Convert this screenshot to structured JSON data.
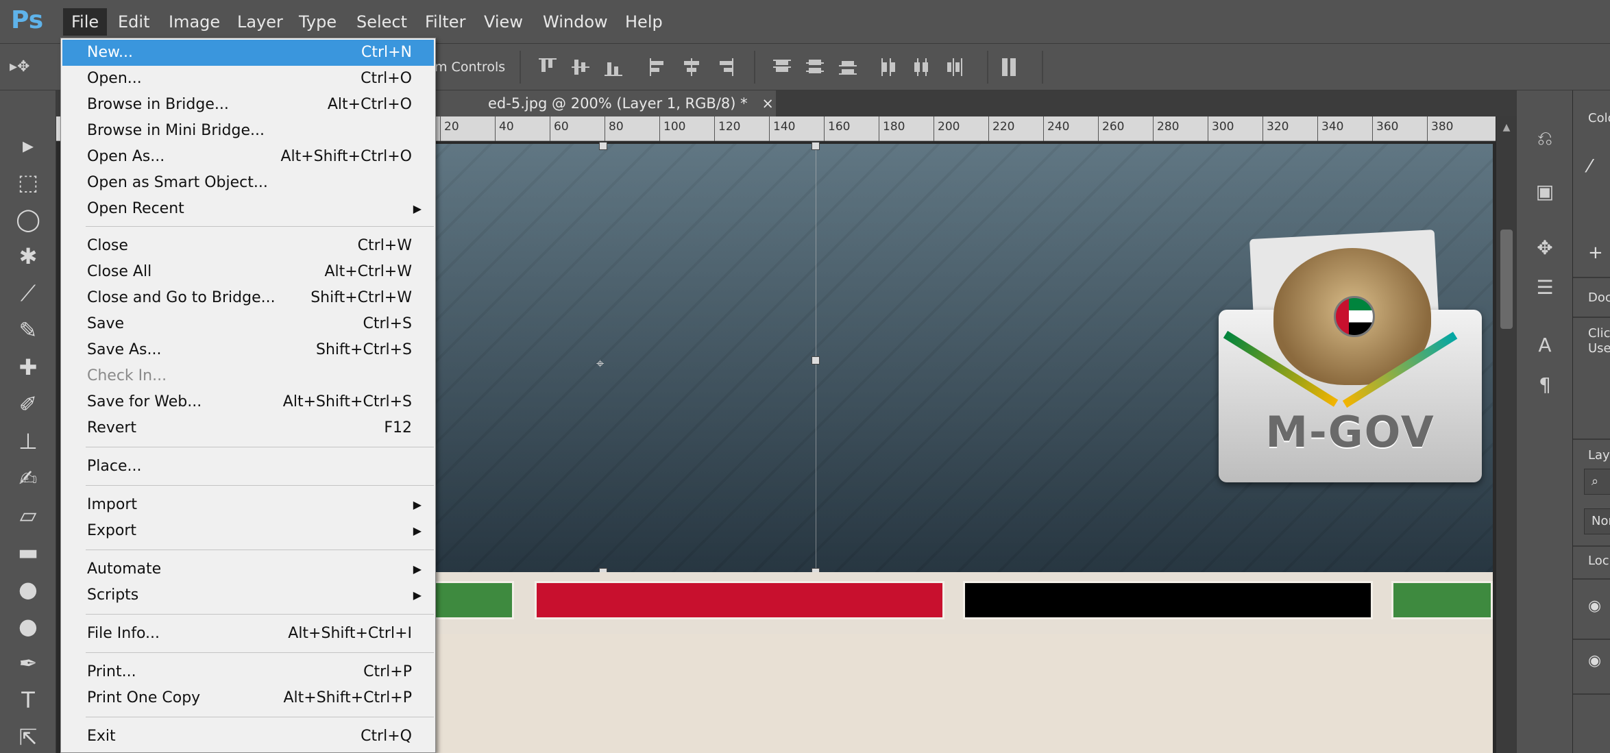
{
  "app": {
    "logo": "Ps"
  },
  "menubar": {
    "items": [
      "File",
      "Edit",
      "Image",
      "Layer",
      "Type",
      "Select",
      "Filter",
      "View",
      "Window",
      "Help"
    ]
  },
  "options_bar": {
    "transform_controls_fragment": "m Controls"
  },
  "document": {
    "tab_title": "ed-5.jpg @ 200% (Layer 1, RGB/8) *",
    "close_glyph": "×",
    "ruler_labels": [
      "20",
      "40",
      "60",
      "80",
      "100",
      "120",
      "140",
      "160",
      "180",
      "200",
      "220",
      "240",
      "260",
      "280",
      "300",
      "320",
      "340",
      "360",
      "380"
    ]
  },
  "canvas": {
    "logo_text": "M-GOV",
    "bar_colors": [
      "#3e8a3f",
      "#c8102e",
      "#000000",
      "#3e8a3f"
    ]
  },
  "file_menu": {
    "items": [
      {
        "label": "New...",
        "shortcut": "Ctrl+N",
        "highlighted": true
      },
      {
        "label": "Open...",
        "shortcut": "Ctrl+O"
      },
      {
        "label": "Browse in Bridge...",
        "shortcut": "Alt+Ctrl+O"
      },
      {
        "label": "Browse in Mini Bridge...",
        "shortcut": ""
      },
      {
        "label": "Open As...",
        "shortcut": "Alt+Shift+Ctrl+O"
      },
      {
        "label": "Open as Smart Object...",
        "shortcut": ""
      },
      {
        "label": "Open Recent",
        "shortcut": "",
        "submenu": true
      },
      {
        "label": "Close",
        "shortcut": "Ctrl+W"
      },
      {
        "label": "Close All",
        "shortcut": "Alt+Ctrl+W"
      },
      {
        "label": "Close and Go to Bridge...",
        "shortcut": "Shift+Ctrl+W"
      },
      {
        "label": "Save",
        "shortcut": "Ctrl+S"
      },
      {
        "label": "Save As...",
        "shortcut": "Shift+Ctrl+S"
      },
      {
        "label": "Check In...",
        "shortcut": "",
        "disabled": true
      },
      {
        "label": "Save for Web...",
        "shortcut": "Alt+Shift+Ctrl+S"
      },
      {
        "label": "Revert",
        "shortcut": "F12"
      },
      {
        "label": "Place...",
        "shortcut": ""
      },
      {
        "label": "Import",
        "shortcut": "",
        "submenu": true
      },
      {
        "label": "Export",
        "shortcut": "",
        "submenu": true
      },
      {
        "label": "Automate",
        "shortcut": "",
        "submenu": true
      },
      {
        "label": "Scripts",
        "shortcut": "",
        "submenu": true
      },
      {
        "label": "File Info...",
        "shortcut": "Alt+Shift+Ctrl+I"
      },
      {
        "label": "Print...",
        "shortcut": "Ctrl+P"
      },
      {
        "label": "Print One Copy",
        "shortcut": "Alt+Shift+Ctrl+P"
      },
      {
        "label": "Exit",
        "shortcut": "Ctrl+Q"
      }
    ]
  },
  "right_panels": {
    "color_tab_fragment": "Colo",
    "doc_fragment": "Doc",
    "click_fragment": "Clic",
    "use_fragment": "Use",
    "layers_fragment": "Laye",
    "blend_fragment": "Nor",
    "lock_fragment": "Lock"
  }
}
